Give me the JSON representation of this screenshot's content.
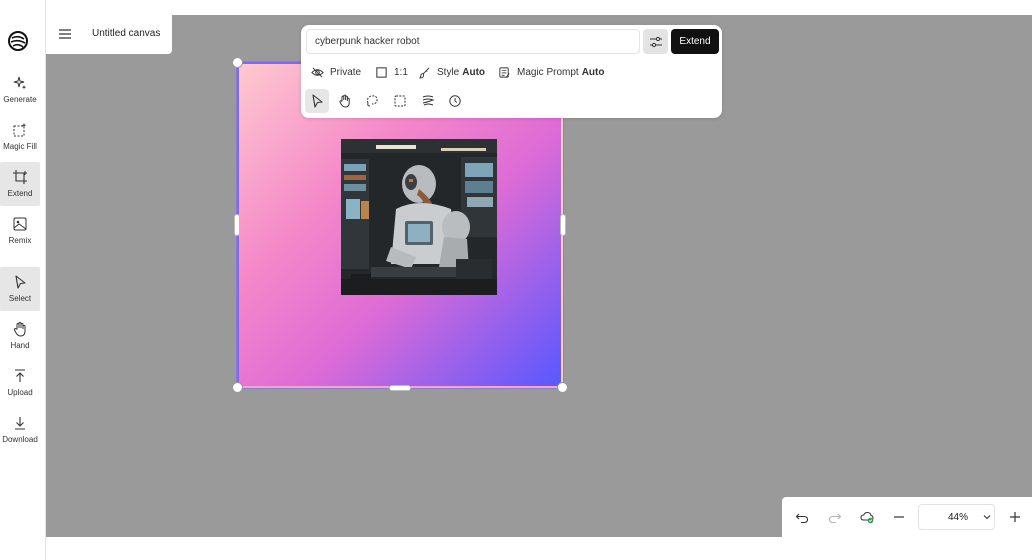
{
  "app": {
    "canvas_title": "Untitled canvas"
  },
  "sidebar": {
    "items": [
      {
        "label": "Generate",
        "icon": "sparkle-icon",
        "active": false
      },
      {
        "label": "Magic Fill",
        "icon": "magic-fill-icon",
        "active": false
      },
      {
        "label": "Extend",
        "icon": "crop-extend-icon",
        "active": true
      },
      {
        "label": "Remix",
        "icon": "remix-icon",
        "active": false
      },
      {
        "label": "Select",
        "icon": "cursor-icon",
        "active": true
      },
      {
        "label": "Hand",
        "icon": "hand-icon",
        "active": false
      },
      {
        "label": "Upload",
        "icon": "upload-icon",
        "active": false
      },
      {
        "label": "Download",
        "icon": "download-icon",
        "active": false
      }
    ]
  },
  "prompt_panel": {
    "prompt_value": "cyberpunk hacker robot",
    "submit_label": "Extend",
    "options": {
      "visibility": "Private",
      "aspect_ratio": "1:1",
      "style_label": "Style",
      "style_value": "Auto",
      "magic_prompt_label": "Magic Prompt",
      "magic_prompt_value": "Auto"
    }
  },
  "zoom": {
    "level": "44%"
  },
  "colors": {
    "accent": "#111111",
    "canvas_bg": "#9a9a9a",
    "frame_border": "#7a68ff"
  }
}
